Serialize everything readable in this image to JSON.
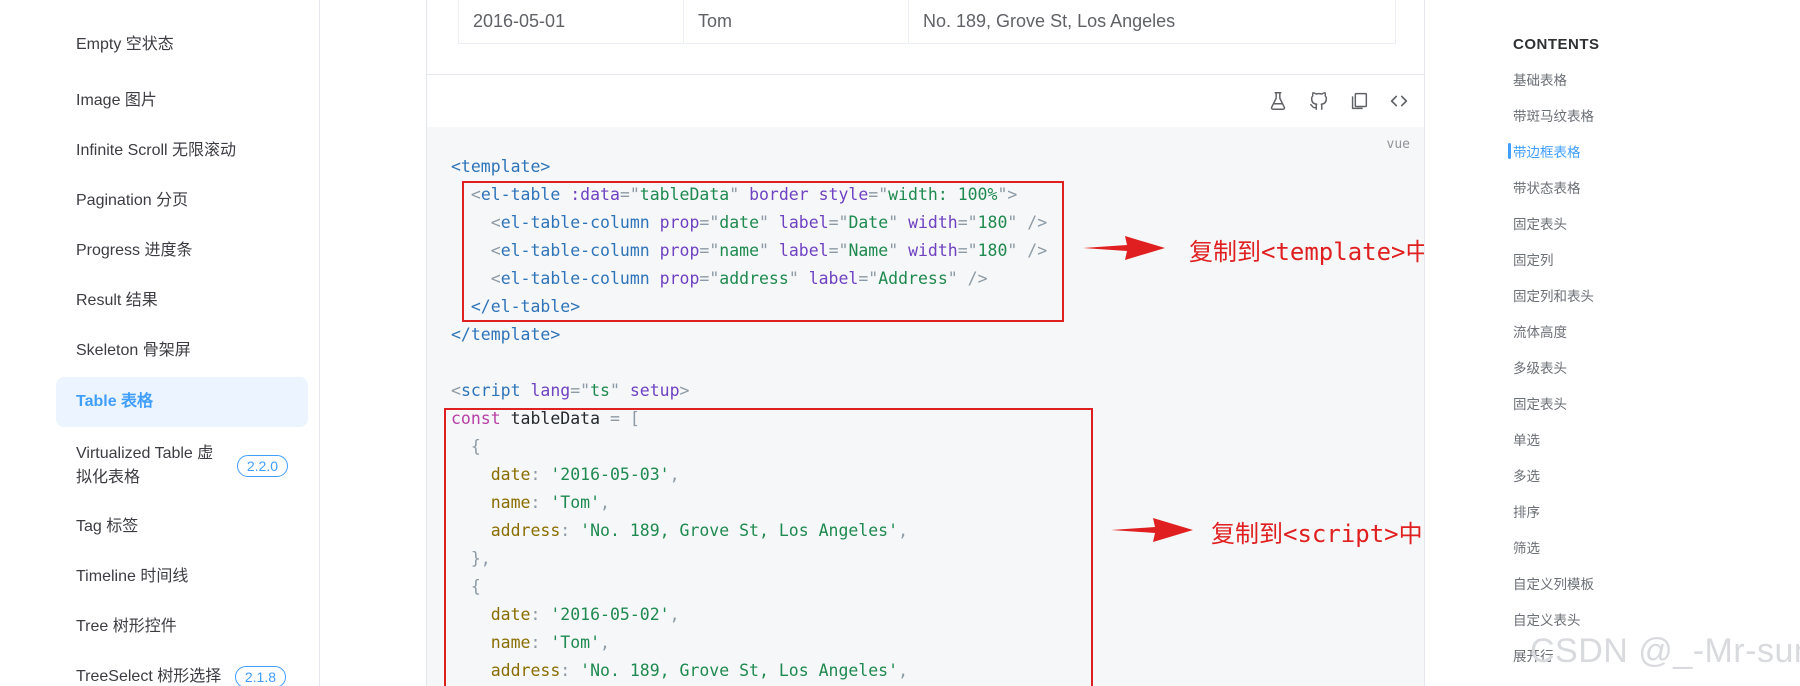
{
  "sidebar": {
    "items": [
      {
        "label": "Empty 空状态"
      },
      {
        "label": "Image 图片"
      },
      {
        "label": "Infinite Scroll 无限滚动"
      },
      {
        "label": "Pagination 分页"
      },
      {
        "label": "Progress 进度条"
      },
      {
        "label": "Result 结果"
      },
      {
        "label": "Skeleton 骨架屏"
      },
      {
        "label": "Table 表格",
        "active": true
      },
      {
        "label": "Virtualized Table 虚拟化表格",
        "line1": "Virtualized Table 虚",
        "line2": "拟化表格",
        "badge": "2.2.0"
      },
      {
        "label": "Tag 标签"
      },
      {
        "label": "Timeline 时间线"
      },
      {
        "label": "Tree 树形控件"
      },
      {
        "label": "TreeSelect 树形选择",
        "badge": "2.1.8"
      }
    ]
  },
  "table_row": {
    "date": "2016-05-01",
    "name": "Tom",
    "address": "No. 189, Grove St, Los Angeles"
  },
  "toolbar": {
    "icons": [
      "playground-flask-icon",
      "github-icon",
      "copy-icon",
      "code-icon"
    ]
  },
  "code": {
    "lang": "vue",
    "template_open": "<template>",
    "template_close": "</template>",
    "table_open": {
      "tag": "el-table",
      "attr1": ":data",
      "val1": "tableData",
      "attr2": "border",
      "attr3": "style",
      "val3": "width: 100%"
    },
    "columns": [
      {
        "tag": "el-table-column",
        "prop": "date",
        "label_attr": "label",
        "label": "Date",
        "width": "180"
      },
      {
        "tag": "el-table-column",
        "prop": "name",
        "label_attr": "label",
        "label": "Name",
        "width": "180"
      },
      {
        "tag": "el-table-column",
        "prop": "address",
        "label_attr": "label",
        "label": "Address"
      }
    ],
    "table_close": "</el-table>",
    "script_open": {
      "tag": "script",
      "attr1": "lang",
      "val1": "ts",
      "attr2": "setup"
    },
    "const_kw": "const",
    "const_name": "tableData",
    "rows": [
      {
        "date": "'2016-05-03'",
        "name": "'Tom'",
        "address": "'No. 189, Grove St, Los Angeles'"
      },
      {
        "date": "'2016-05-02'",
        "name": "'Tom'",
        "address": "'No. 189, Grove St, Los Angeles'"
      }
    ]
  },
  "annotations": {
    "template_note": "复制到<template>中",
    "script_note": "复制到<script>中"
  },
  "toc": {
    "title": "CONTENTS",
    "items": [
      "基础表格",
      "带斑马纹表格",
      "带边框表格",
      "带状态表格",
      "固定表头",
      "固定列",
      "固定列和表头",
      "流体高度",
      "多级表头",
      "固定表头",
      "单选",
      "多选",
      "排序",
      "筛选",
      "自定义列模板",
      "自定义表头",
      "展开行"
    ],
    "active_index": 2
  },
  "watermark": "CSDN @_-Mr-sun",
  "colors": {
    "accent": "#409eff",
    "annotation": "#e02020",
    "code_bg": "#f6f7f9"
  }
}
